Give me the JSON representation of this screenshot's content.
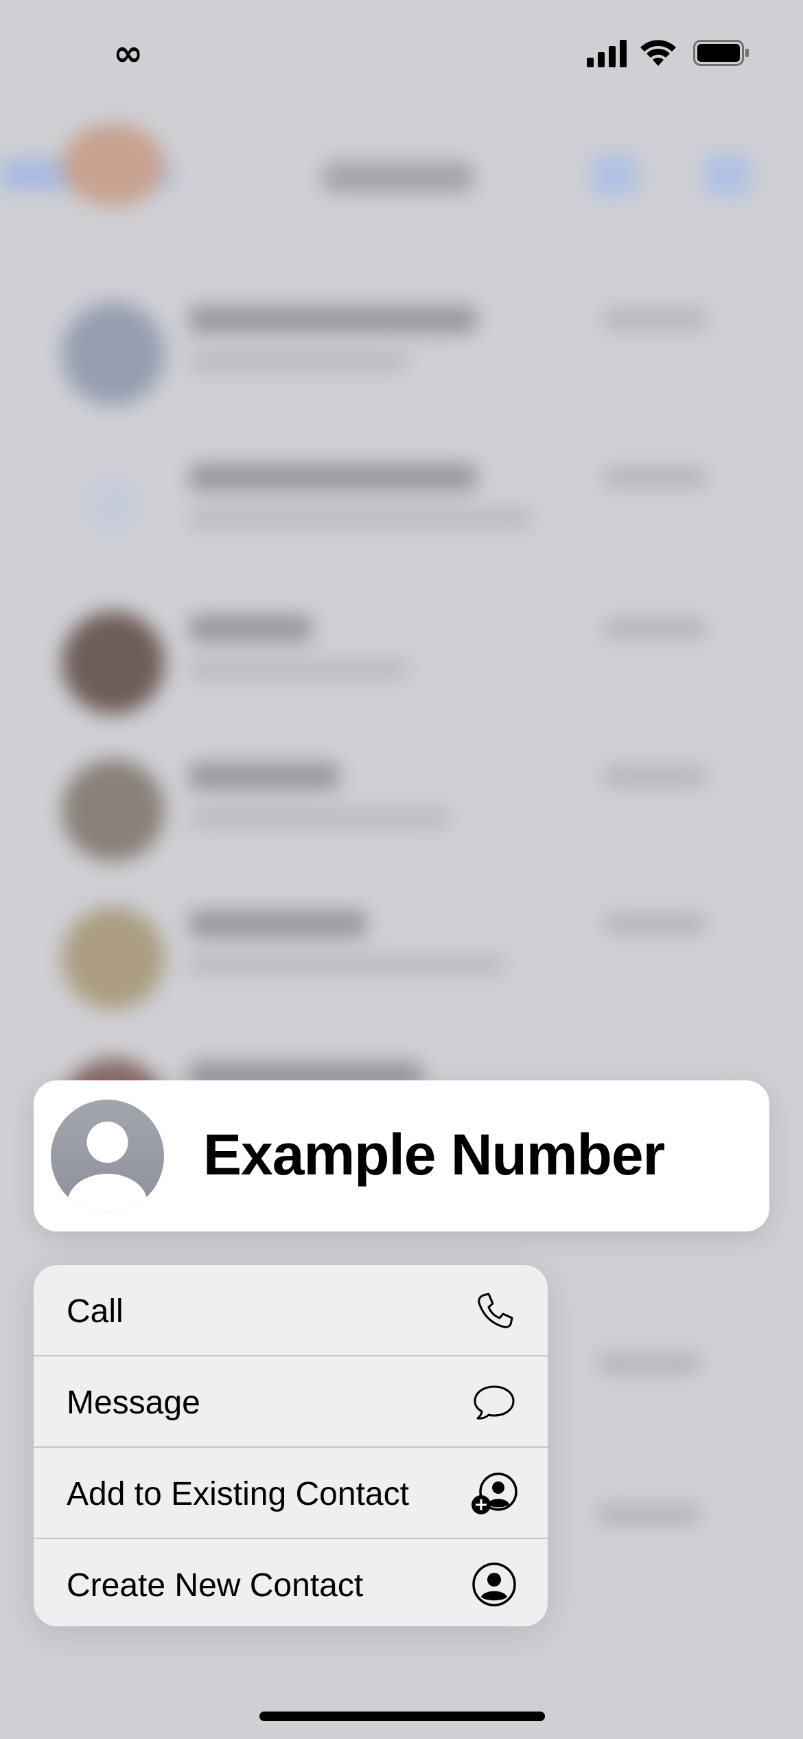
{
  "status_bar": {
    "left_glyph": "∞",
    "icons": [
      "signal-icon",
      "wifi-icon",
      "battery-icon"
    ]
  },
  "contact_header": {
    "name": "Example Number",
    "avatar_icon": "person-silhouette-icon"
  },
  "menu": {
    "items": [
      {
        "label": "Call",
        "icon": "phone-icon"
      },
      {
        "label": "Message",
        "icon": "speech-bubble-icon"
      },
      {
        "label": "Add to Existing Contact",
        "icon": "add-person-icon"
      },
      {
        "label": "Create New Contact",
        "icon": "person-circle-icon"
      }
    ]
  },
  "colors": {
    "backdrop": "#cfcfd4",
    "card": "#ffffff",
    "menu": "#f0f0f2",
    "text": "#000000"
  }
}
